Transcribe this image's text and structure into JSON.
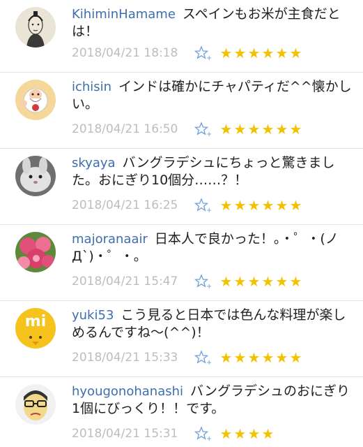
{
  "comments": [
    {
      "user": "KihiminHamame",
      "text": "スペインもお米が主食だとは！",
      "date": "2018/04/21 18:18",
      "stars": 6
    },
    {
      "user": "ichisin",
      "text": "インドは確かにチャパティだ^^懐かしい。",
      "date": "2018/04/21 16:50",
      "stars": 6
    },
    {
      "user": "skyaya",
      "text": "バングラデシュにちょっと驚きました。おにぎり10個分……？！",
      "date": "2018/04/21 16:25",
      "stars": 6
    },
    {
      "user": "majoranaair",
      "text": "日本人で良かった！。・゜・(ノД`)・゜・。",
      "date": "2018/04/21 15:47",
      "stars": 6
    },
    {
      "user": "yuki53",
      "text": "こう見ると日本では色んな料理が楽しめるんですね〜(^^)！",
      "date": "2018/04/21 15:33",
      "stars": 6,
      "avatar_text": "mi"
    },
    {
      "user": "hyougonohanashi",
      "text": "バングラデシュのおにぎり1個にびっくり！！です。",
      "date": "2018/04/21 15:31",
      "stars": 4
    }
  ],
  "colors": {
    "username": "#3d6fae",
    "date": "#bdbdbd",
    "star": "#f2c200",
    "add_star": "#6fa0d8"
  },
  "icons": {
    "star": "★",
    "add_star": "add-star-icon"
  }
}
